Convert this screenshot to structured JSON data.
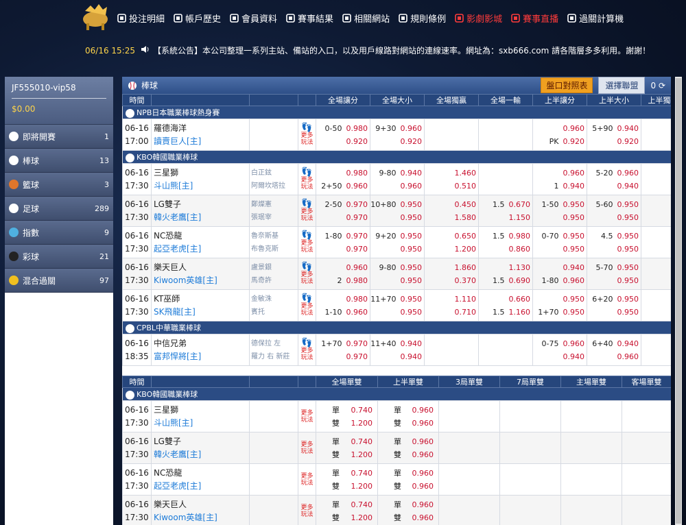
{
  "nav": [
    {
      "label": "投注明細",
      "icon": "list-icon",
      "color": "#ffffff"
    },
    {
      "label": "帳戶歷史",
      "icon": "book-icon",
      "color": "#ffffff"
    },
    {
      "label": "會員資料",
      "icon": "user-icon",
      "color": "#ffffff"
    },
    {
      "label": "賽事結果",
      "icon": "trophy-icon",
      "color": "#ffffff"
    },
    {
      "label": "相關網站",
      "icon": "globe-icon",
      "color": "#ffffff"
    },
    {
      "label": "規則條例",
      "icon": "pencil-icon",
      "color": "#ffffff"
    },
    {
      "label": "影劇影城",
      "icon": "film-icon",
      "color": "#ff3b3b"
    },
    {
      "label": "賽事直播",
      "icon": "tv-icon",
      "color": "#ff3b3b"
    },
    {
      "label": "過關計算機",
      "icon": "calculator-icon",
      "color": "#ffffff"
    }
  ],
  "announcement": {
    "time": "06/16 15:25",
    "text": "【系統公告】本公司整理一系列主站、備站的入口，以及用戶線路對網站的連線速率。網址為：sxb666.com 請各階層多多利用。謝謝！"
  },
  "account": {
    "user": "JF555010-vip58",
    "balance": "$0.00"
  },
  "menu": [
    {
      "label": "即將開賽",
      "count": "1",
      "color": "#ffffff"
    },
    {
      "label": "棒球",
      "count": "13",
      "color": "#ffffff"
    },
    {
      "label": "籃球",
      "count": "3",
      "color": "#e0762b"
    },
    {
      "label": "足球",
      "count": "289",
      "color": "#ffffff"
    },
    {
      "label": "指數",
      "count": "9",
      "color": "#4fb0e0"
    },
    {
      "label": "彩球",
      "count": "21",
      "color": "#222222"
    },
    {
      "label": "混合過關",
      "count": "97",
      "color": "#f0c020"
    }
  ],
  "header": {
    "title": "棒球",
    "odds_btn": "盤口對照表",
    "league_btn": "選擇聯盟",
    "refresh": "0"
  },
  "cols1": [
    "時間",
    "",
    "",
    "全場讓分",
    "全場大小",
    "全場獨贏",
    "全場一輸",
    "上半讓分",
    "上半大小",
    "上半獨贏"
  ],
  "more": "更多玩法",
  "leagues": [
    {
      "name": "NPB日本職業棒球熱身賽",
      "matches": [
        {
          "date": "06-16",
          "time": "17:00",
          "home": "羅德海洋",
          "away": "讀賣巨人[主]",
          "p1": "",
          "p2": "",
          "hc": [
            [
              "0-50",
              "0.980"
            ],
            [
              "",
              "0.920"
            ]
          ],
          "ou": [
            [
              "9+30",
              "0.960"
            ],
            [
              "",
              "0.920"
            ]
          ],
          "ml": [
            [
              "",
              ""
            ],
            [
              "",
              ""
            ]
          ],
          "one": [
            [
              "",
              ""
            ],
            [
              "",
              ""
            ]
          ],
          "h1": [
            [
              "",
              "0.960"
            ],
            [
              "PK",
              "0.920"
            ]
          ],
          "ou1": [
            [
              "5+90",
              "0.940"
            ],
            [
              "",
              "0.920"
            ]
          ]
        }
      ]
    },
    {
      "name": "KBO韓國職業棒球",
      "matches": [
        {
          "date": "06-16",
          "time": "17:30",
          "home": "三星獅",
          "away": "斗山熊[主]",
          "p1": "白正鉉",
          "p2": "阿爾坎塔拉",
          "hc": [
            [
              "",
              "0.980"
            ],
            [
              "2+50",
              "0.960"
            ]
          ],
          "ou": [
            [
              "9-80",
              "0.940"
            ],
            [
              "",
              "0.960"
            ]
          ],
          "ml": [
            [
              "",
              "1.460"
            ],
            [
              "",
              "0.510"
            ]
          ],
          "one": [
            [
              "",
              ""
            ],
            [
              "",
              ""
            ]
          ],
          "h1": [
            [
              "",
              "0.960"
            ],
            [
              "1",
              "0.940"
            ]
          ],
          "ou1": [
            [
              "5-20",
              "0.960"
            ],
            [
              "",
              "0.940"
            ]
          ]
        },
        {
          "date": "06-16",
          "time": "17:30",
          "home": "LG雙子",
          "away": "韓火老鷹[主]",
          "p1": "鄭燦憲",
          "p2": "張珉宰",
          "hc": [
            [
              "2-50",
              "0.970"
            ],
            [
              "",
              "0.970"
            ]
          ],
          "ou": [
            [
              "10+80",
              "0.950"
            ],
            [
              "",
              "0.950"
            ]
          ],
          "ml": [
            [
              "",
              "0.450"
            ],
            [
              "",
              "1.580"
            ]
          ],
          "one": [
            [
              "1.5",
              "0.670"
            ],
            [
              "",
              "1.150"
            ]
          ],
          "h1": [
            [
              "1-50",
              "0.950"
            ],
            [
              "",
              "0.950"
            ]
          ],
          "ou1": [
            [
              "5-60",
              "0.950"
            ],
            [
              "",
              "0.950"
            ]
          ]
        },
        {
          "date": "06-16",
          "time": "17:30",
          "home": "NC恐龍",
          "away": "起亞老虎[主]",
          "p1": "魯奈斯基",
          "p2": "布魯克斯",
          "hc": [
            [
              "1-80",
              "0.970"
            ],
            [
              "",
              "0.970"
            ]
          ],
          "ou": [
            [
              "9+20",
              "0.950"
            ],
            [
              "",
              "0.950"
            ]
          ],
          "ml": [
            [
              "",
              "0.650"
            ],
            [
              "",
              "1.200"
            ]
          ],
          "one": [
            [
              "1.5",
              "0.980"
            ],
            [
              "",
              "0.860"
            ]
          ],
          "h1": [
            [
              "0-70",
              "0.950"
            ],
            [
              "",
              "0.950"
            ]
          ],
          "ou1": [
            [
              "4.5",
              "0.950"
            ],
            [
              "",
              "0.950"
            ]
          ]
        },
        {
          "date": "06-16",
          "time": "17:30",
          "home": "樂天巨人",
          "away": "Kiwoom英雄[主]",
          "p1": "盧景銀",
          "p2": "馬奇許",
          "hc": [
            [
              "",
              "0.960"
            ],
            [
              "2",
              "0.980"
            ]
          ],
          "ou": [
            [
              "9-80",
              "0.950"
            ],
            [
              "",
              "0.950"
            ]
          ],
          "ml": [
            [
              "",
              "1.860"
            ],
            [
              "",
              "0.370"
            ]
          ],
          "one": [
            [
              "",
              "1.130"
            ],
            [
              "1.5",
              "0.690"
            ]
          ],
          "h1": [
            [
              "",
              "0.940"
            ],
            [
              "1-80",
              "0.960"
            ]
          ],
          "ou1": [
            [
              "5-70",
              "0.950"
            ],
            [
              "",
              "0.950"
            ]
          ]
        },
        {
          "date": "06-16",
          "time": "17:30",
          "home": "KT巫師",
          "away": "SK飛龍[主]",
          "p1": "金敏洙",
          "p2": "賓托",
          "hc": [
            [
              "",
              "0.980"
            ],
            [
              "1-10",
              "0.960"
            ]
          ],
          "ou": [
            [
              "11+70",
              "0.950"
            ],
            [
              "",
              "0.950"
            ]
          ],
          "ml": [
            [
              "",
              "1.110"
            ],
            [
              "",
              "0.710"
            ]
          ],
          "one": [
            [
              "",
              "0.660"
            ],
            [
              "1.5",
              "1.160"
            ]
          ],
          "h1": [
            [
              "",
              "0.950"
            ],
            [
              "1+70",
              "0.950"
            ]
          ],
          "ou1": [
            [
              "6+20",
              "0.950"
            ],
            [
              "",
              "0.950"
            ]
          ]
        }
      ]
    },
    {
      "name": "CPBL中華職業棒球",
      "matches": [
        {
          "date": "06-16",
          "time": "18:35",
          "home": "中信兄弟",
          "away": "富邦悍將[主]",
          "p1": "德保拉 左",
          "p2": "羅力 右 新莊",
          "hc": [
            [
              "1+70",
              "0.970"
            ],
            [
              "",
              "0.970"
            ]
          ],
          "ou": [
            [
              "11+40",
              "0.940"
            ],
            [
              "",
              "0.940"
            ]
          ],
          "ml": [
            [
              "",
              ""
            ],
            [
              "",
              ""
            ]
          ],
          "one": [
            [
              "",
              ""
            ],
            [
              "",
              ""
            ]
          ],
          "h1": [
            [
              "0-75",
              "0.960"
            ],
            [
              "",
              "0.940"
            ]
          ],
          "ou1": [
            [
              "6+40",
              "0.940"
            ],
            [
              "",
              "0.960"
            ]
          ]
        }
      ]
    }
  ],
  "cols2": [
    "時間",
    "",
    "",
    "全場單雙",
    "上半單雙",
    "3局單雙",
    "7局單雙",
    "主場單雙",
    "客場單雙"
  ],
  "oe_league": "KBO韓國職業棒球",
  "oe_keys": [
    "單",
    "雙"
  ],
  "oe_matches": [
    {
      "date": "06-16",
      "time": "17:30",
      "home": "三星獅",
      "away": "斗山熊[主]",
      "full": [
        "0.740",
        "1.200"
      ],
      "half": [
        "0.960",
        "0.960"
      ]
    },
    {
      "date": "06-16",
      "time": "17:30",
      "home": "LG雙子",
      "away": "韓火老鷹[主]",
      "full": [
        "0.740",
        "1.200"
      ],
      "half": [
        "0.960",
        "0.960"
      ]
    },
    {
      "date": "06-16",
      "time": "17:30",
      "home": "NC恐龍",
      "away": "起亞老虎[主]",
      "full": [
        "0.740",
        "1.200"
      ],
      "half": [
        "0.960",
        "0.960"
      ]
    },
    {
      "date": "06-16",
      "time": "17:30",
      "home": "樂天巨人",
      "away": "Kiwoom英雄[主]",
      "full": [
        "0.740",
        "1.200"
      ],
      "half": [
        "0.960",
        "0.960"
      ]
    }
  ]
}
